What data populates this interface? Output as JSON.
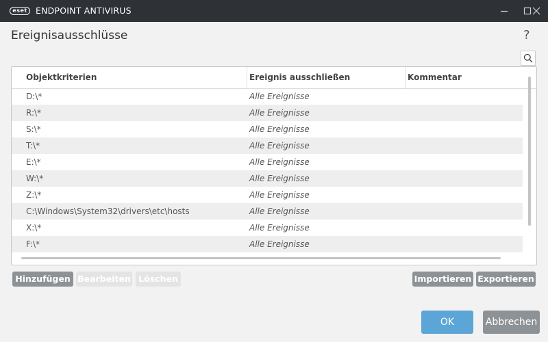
{
  "window": {
    "logo_text": "eset",
    "product_name": "ENDPOINT ANTIVIRUS"
  },
  "header": {
    "title": "Ereignisausschlüsse",
    "help": "?"
  },
  "table": {
    "columns": [
      "Objektkriterien",
      "Ereignis ausschließen",
      "Kommentar"
    ],
    "rows": [
      {
        "object": "D:\\*",
        "event": "Alle Ereignisse",
        "comment": ""
      },
      {
        "object": "R:\\*",
        "event": "Alle Ereignisse",
        "comment": ""
      },
      {
        "object": "S:\\*",
        "event": "Alle Ereignisse",
        "comment": ""
      },
      {
        "object": "T:\\*",
        "event": "Alle Ereignisse",
        "comment": ""
      },
      {
        "object": "E:\\*",
        "event": "Alle Ereignisse",
        "comment": ""
      },
      {
        "object": "W:\\*",
        "event": "Alle Ereignisse",
        "comment": ""
      },
      {
        "object": "Z:\\*",
        "event": "Alle Ereignisse",
        "comment": ""
      },
      {
        "object": "C:\\Windows\\System32\\drivers\\etc\\hosts",
        "event": "Alle Ereignisse",
        "comment": ""
      },
      {
        "object": "X:\\*",
        "event": "Alle Ereignisse",
        "comment": ""
      },
      {
        "object": "F:\\*",
        "event": "Alle Ereignisse",
        "comment": ""
      }
    ]
  },
  "actions": {
    "add": "Hinzufügen",
    "edit": "Bearbeiten",
    "delete": "Löschen",
    "import": "Importieren",
    "export": "Exportieren"
  },
  "dialog": {
    "ok": "OK",
    "cancel": "Abbrechen"
  },
  "colors": {
    "titlebar": "#2e3236",
    "ok_button": "#5ba6d6",
    "cancel_button": "#8d9296",
    "action_button": "#8d9296",
    "disabled_button": "#e4e4e4"
  },
  "icons": {
    "minimize": "minimize-icon",
    "maximize": "maximize-icon",
    "close": "close-icon",
    "search": "search-icon"
  }
}
